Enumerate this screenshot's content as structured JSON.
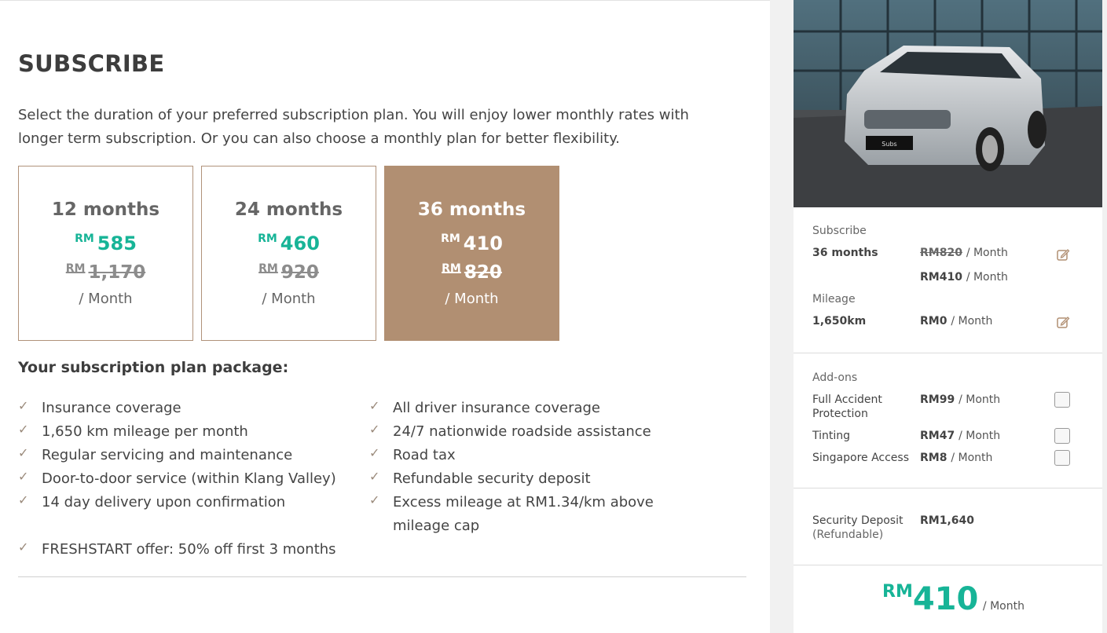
{
  "page": {
    "title": "SUBSCRIBE",
    "intro": "Select the duration of your preferred subscription plan. You will enjoy lower monthly rates with longer term subscription. Or you can also choose a monthly plan for better flexibility."
  },
  "plans": [
    {
      "duration": "12 months",
      "currency": "RM",
      "price": "585",
      "original": "1,170",
      "per": "/ Month",
      "selected": false
    },
    {
      "duration": "24 months",
      "currency": "RM",
      "price": "460",
      "original": "920",
      "per": "/ Month",
      "selected": false
    },
    {
      "duration": "36 months",
      "currency": "RM",
      "price": "410",
      "original": "820",
      "per": "/ Month",
      "selected": true
    }
  ],
  "package": {
    "title": "Your subscription plan package:",
    "left": [
      "Insurance coverage",
      "1,650 km mileage per month",
      "Regular servicing and maintenance",
      "Door-to-door service (within Klang Valley)",
      "14 day delivery upon confirmation",
      "FRESHSTART offer: 50% off first 3 months"
    ],
    "right": [
      "All driver insurance coverage",
      "24/7 nationwide roadside assistance",
      "Road tax",
      "Refundable security deposit",
      "Excess mileage at RM1.34/km above",
      "mileage cap"
    ]
  },
  "summary": {
    "car_plate": "Subs",
    "subscribe_label": "Subscribe",
    "subscribe_value": "36 months",
    "subscribe_original": "RM820",
    "subscribe_price": "RM410",
    "per_month": "/ Month",
    "mileage_label": "Mileage",
    "mileage_value": "1,650km",
    "mileage_price": "RM0",
    "addons_label": "Add-ons",
    "addons": [
      {
        "name": "Full Accident",
        "name2": "Protection",
        "price": "RM99",
        "checked": false
      },
      {
        "name": "Tinting",
        "name2": "",
        "price": "RM47",
        "checked": false
      },
      {
        "name": "Singapore Access",
        "name2": "",
        "price": "RM8",
        "checked": false
      }
    ],
    "deposit_label": "Security Deposit",
    "deposit_sub": "(Refundable)",
    "deposit_value": "RM1,640",
    "total_currency": "RM",
    "total_amount": "410",
    "total_unit": "/ Month"
  },
  "colors": {
    "accent": "#17b497",
    "selected_plan": "#b18f72",
    "check": "#9b8b7c"
  },
  "icons": [
    "check-icon",
    "edit-icon",
    "checkbox"
  ]
}
